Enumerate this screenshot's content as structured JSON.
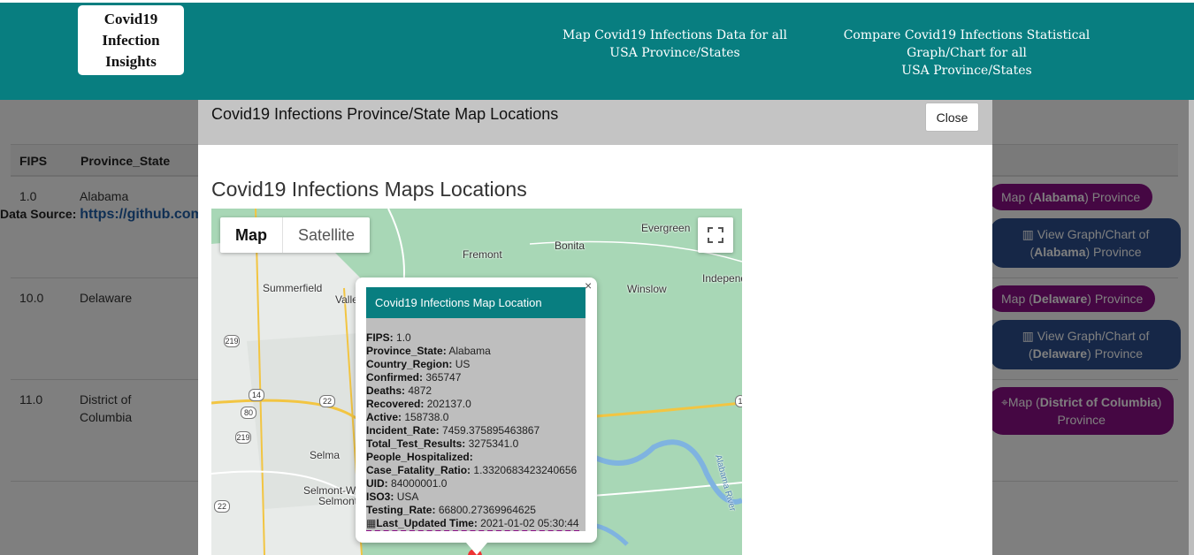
{
  "brand": {
    "line1": "Covid19 Infection",
    "line2": "Insights"
  },
  "nav": {
    "link1_line1": "Map Covid19 Infections Data for all",
    "link1_line2": "USA Province/States",
    "link2_line1": "Compare Covid19 Infections Statistical",
    "link2_line2": "Graph/Chart for all",
    "link2_line3": "USA Province/States"
  },
  "page": {
    "datasource_label": "Data Source:",
    "datasource_link": "https://github.com",
    "table_headers": {
      "fips": "FIPS",
      "province": "Province_State"
    },
    "rows": [
      {
        "fips": "1.0",
        "province": "Alabama",
        "map_btn_prefix": "Map (",
        "map_btn_name": "Alabama",
        "map_btn_suffix": ") Province",
        "graph_line1": "View Graph/Chart of",
        "graph_name": "Alabama",
        "graph_suffix": ") Province"
      },
      {
        "fips": "10.0",
        "province": "Delaware",
        "map_btn_prefix": "Map (",
        "map_btn_name": "Delaware",
        "map_btn_suffix": ") Province",
        "graph_line1": "View Graph/Chart of",
        "graph_name": "Delaware",
        "graph_suffix": ") Province"
      },
      {
        "fips": "11.0",
        "province_line1": "District of",
        "province_line2": "Columbia",
        "map_btn_prefix": "Map (",
        "map_btn_name": "District of Columbia",
        "map_btn_suffix": ")",
        "map_btn_line2": "Province"
      }
    ]
  },
  "modal": {
    "title": "Covid19 Infections Province/State Map Locations",
    "close_label": "Close",
    "heading": "Covid19 Infections Maps Locations",
    "map_types": {
      "map": "Map",
      "satellite": "Satellite"
    },
    "places": {
      "evergreen": "Evergreen",
      "bonita": "Bonita",
      "fremont": "Fremont",
      "summerfield": "Summerfield",
      "valle": "Valle",
      "winslow": "Winslow",
      "independence": "Independe",
      "selma": "Selma",
      "selmont1": "Selmont-W",
      "selmont2": "Selmont",
      "river": "Alabama River"
    },
    "shields": {
      "r219a": "219",
      "r14": "14",
      "r22a": "22",
      "r80": "80",
      "r219b": "219",
      "r22b": "22",
      "r1": "1"
    },
    "infowindow": {
      "title": "Covid19 Infections Map Location",
      "close": "×",
      "fields": [
        {
          "label": "FIPS:",
          "value": "1.0"
        },
        {
          "label": "Province_State:",
          "value": "Alabama"
        },
        {
          "label": "Country_Region:",
          "value": "US"
        },
        {
          "label": "Confirmed:",
          "value": "365747"
        },
        {
          "label": "Deaths:",
          "value": "4872"
        },
        {
          "label": "Recovered:",
          "value": "202137.0"
        },
        {
          "label": "Active:",
          "value": "158738.0"
        },
        {
          "label": "Incident_Rate:",
          "value": "7459.375895463867"
        },
        {
          "label": "Total_Test_Results:",
          "value": "3275341.0"
        },
        {
          "label": "People_Hospitalized:",
          "value": ""
        },
        {
          "label": "Case_Fatality_Ratio:",
          "value": "1.3320683423240656"
        },
        {
          "label": "UID:",
          "value": "84000001.0"
        },
        {
          "label": "ISO3:",
          "value": "USA"
        },
        {
          "label": "Testing_Rate:",
          "value": "66800.27369964625"
        }
      ],
      "last_updated_label": "Last_Updated Time:",
      "last_updated_value": "2021-01-02 05:30:44"
    }
  },
  "colors": {
    "navbar": "#087e80",
    "map_button": "#8a0f86",
    "graph_button": "#2c4e8f"
  }
}
